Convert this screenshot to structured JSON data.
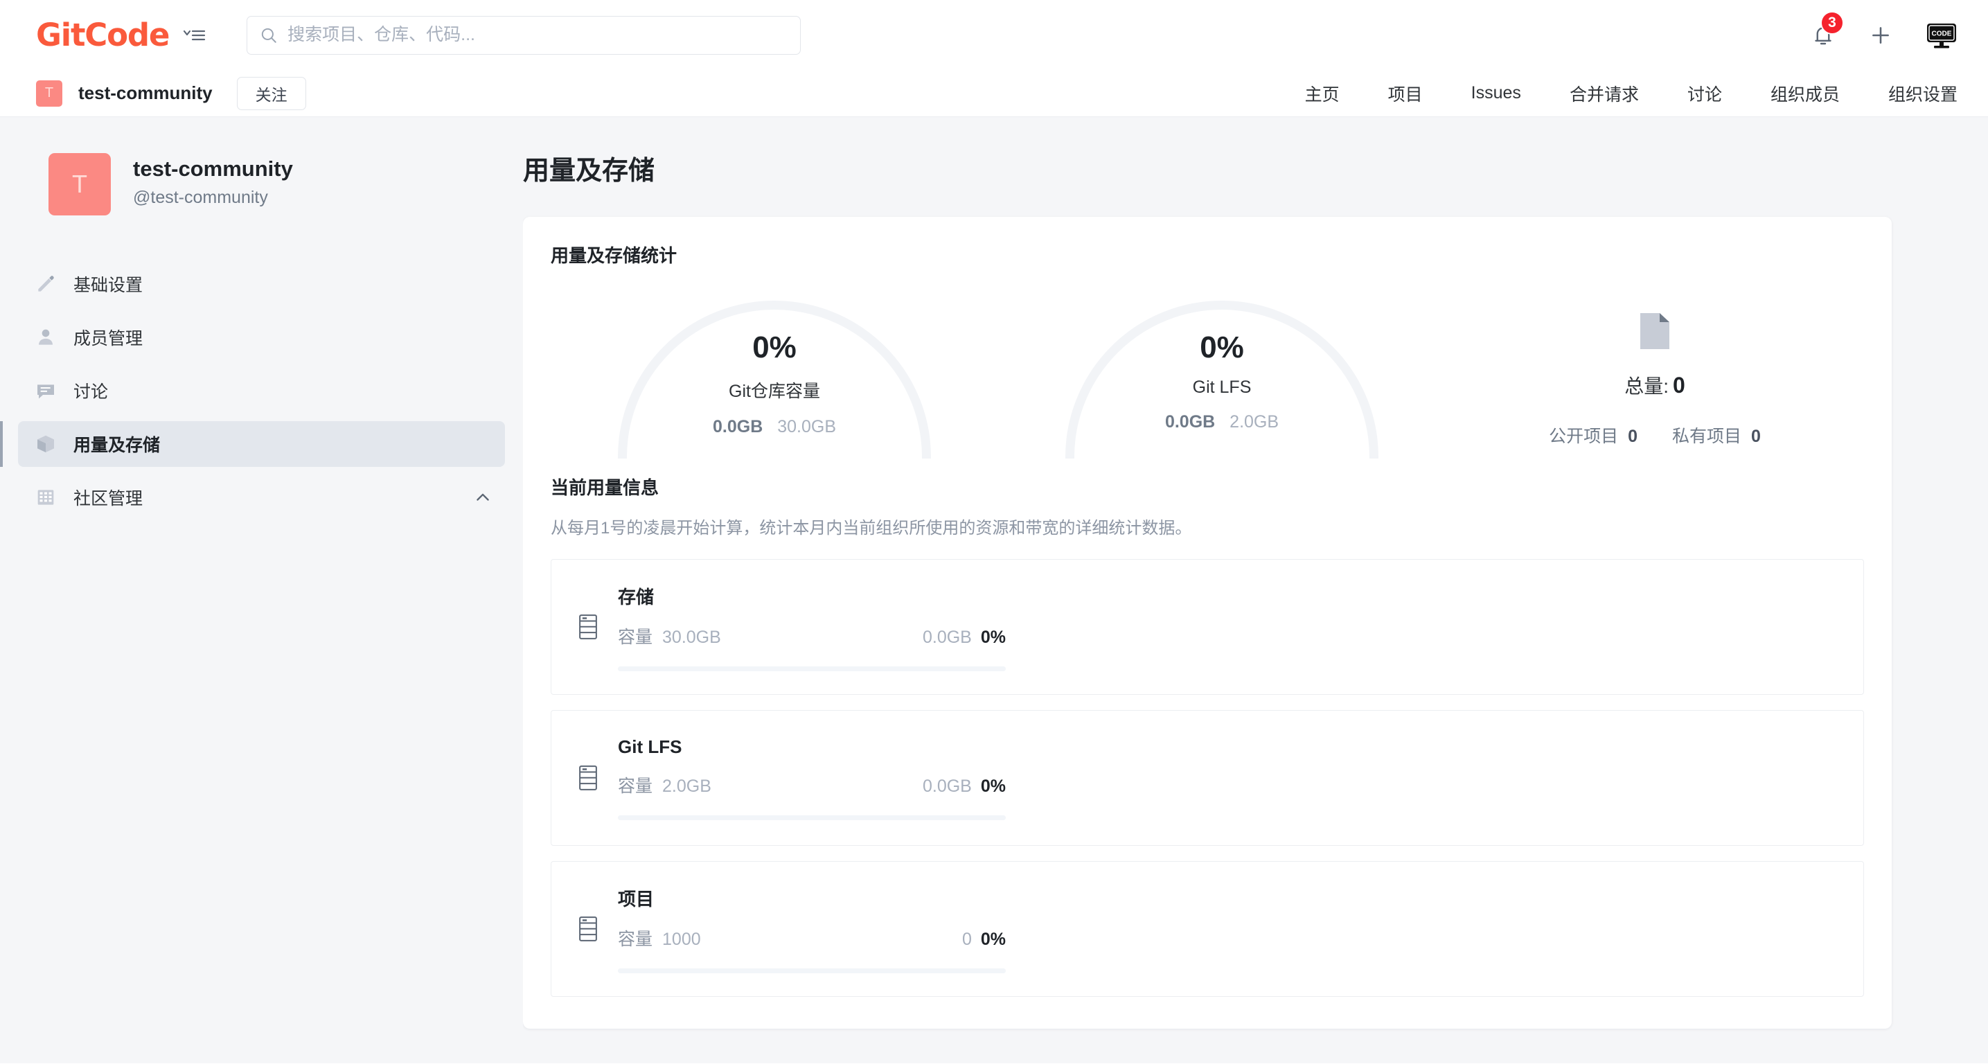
{
  "header": {
    "logo_text": "GitCode",
    "logo_color": "#fa5a3c",
    "menu_icon": "list-chevron-icon",
    "search": {
      "placeholder": "搜索项目、仓库、代码...",
      "value": "",
      "icon": "search-icon"
    },
    "notifications": {
      "icon": "bell-icon",
      "badge": "3",
      "badge_color": "#f5222d"
    },
    "add": {
      "icon": "plus-icon"
    },
    "avatar": {
      "icon": "monitor-code-icon",
      "label": "CODE"
    }
  },
  "orgbar": {
    "avatar_letter": "T",
    "avatar_color": "#fb8983",
    "org_name": "test-community",
    "follow_label": "关注",
    "nav": [
      {
        "label": "主页"
      },
      {
        "label": "项目"
      },
      {
        "label": "Issues"
      },
      {
        "label": "合并请求"
      },
      {
        "label": "讨论"
      },
      {
        "label": "组织成员"
      },
      {
        "label": "组织设置"
      }
    ]
  },
  "sidebar": {
    "avatar_letter": "T",
    "org_title": "test-community",
    "org_handle": "@test-community",
    "items": [
      {
        "label": "基础设置",
        "icon": "pencil-square-icon",
        "active": false,
        "chevron": false
      },
      {
        "label": "成员管理",
        "icon": "user-icon",
        "active": false,
        "chevron": false
      },
      {
        "label": "讨论",
        "icon": "comment-icon",
        "active": false,
        "chevron": false
      },
      {
        "label": "用量及存储",
        "icon": "box-icon",
        "active": true,
        "chevron": false
      },
      {
        "label": "社区管理",
        "icon": "grid-icon",
        "active": false,
        "chevron": true
      }
    ]
  },
  "main": {
    "page_title": "用量及存储",
    "stats_card_title": "用量及存储统计",
    "gauges": [
      {
        "percent": "0%",
        "label": "Git仓库容量",
        "used": "0.0GB",
        "total": "30.0GB",
        "value": 0
      },
      {
        "percent": "0%",
        "label": "Git LFS",
        "used": "0.0GB",
        "total": "2.0GB",
        "value": 0
      }
    ],
    "summary": {
      "icon": "document-icon",
      "total_label": "总量:",
      "total_value": "0",
      "public_label": "公开项目",
      "public_value": "0",
      "private_label": "私有项目",
      "private_value": "0"
    },
    "usage_section": {
      "title": "当前用量信息",
      "description": "从每月1号的凌晨开始计算，统计本月内当前组织所使用的资源和带宽的详细统计数据。",
      "capacity_label": "容量",
      "rows": [
        {
          "icon": "server-icon",
          "name": "存储",
          "capacity": "30.0GB",
          "used": "0.0GB",
          "percent": "0%",
          "value": 0
        },
        {
          "icon": "server-icon",
          "name": "Git LFS",
          "capacity": "2.0GB",
          "used": "0.0GB",
          "percent": "0%",
          "value": 0
        },
        {
          "icon": "server-icon",
          "name": "项目",
          "capacity": "1000",
          "used": "0",
          "percent": "0%",
          "value": 0
        }
      ]
    }
  }
}
